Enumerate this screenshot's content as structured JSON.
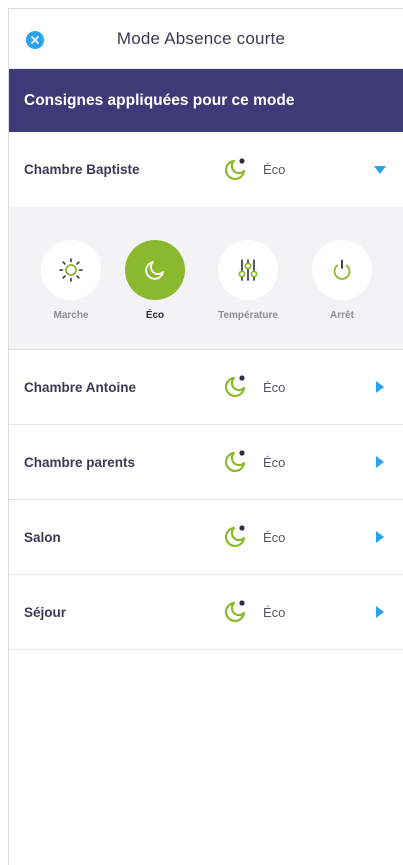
{
  "header": {
    "title": "Mode Absence courte",
    "close_icon": "close-icon"
  },
  "banner": {
    "text": "Consignes appliquées pour ce mode"
  },
  "colors": {
    "accent_blue": "#2aa3ef",
    "banner_bg": "#3e3a78",
    "eco_green": "#8ab92d",
    "panel_bg": "#f3f3f5"
  },
  "rooms": [
    {
      "name": "Chambre Baptiste",
      "mode": "Éco",
      "icon": "moon-icon",
      "expanded": true
    },
    {
      "name": "Chambre Antoine",
      "mode": "Éco",
      "icon": "moon-icon",
      "expanded": false
    },
    {
      "name": "Chambre parents",
      "mode": "Éco",
      "icon": "moon-icon",
      "expanded": false
    },
    {
      "name": "Salon",
      "mode": "Éco",
      "icon": "moon-icon",
      "expanded": false
    },
    {
      "name": "Séjour",
      "mode": "Éco",
      "icon": "moon-icon",
      "expanded": false
    }
  ],
  "mode_options": [
    {
      "label": "Marche",
      "icon": "sun-icon",
      "selected": false
    },
    {
      "label": "Éco",
      "icon": "moon-icon",
      "selected": true
    },
    {
      "label": "Température",
      "icon": "sliders-icon",
      "selected": false
    },
    {
      "label": "Arrêt",
      "icon": "power-icon",
      "selected": false
    }
  ]
}
